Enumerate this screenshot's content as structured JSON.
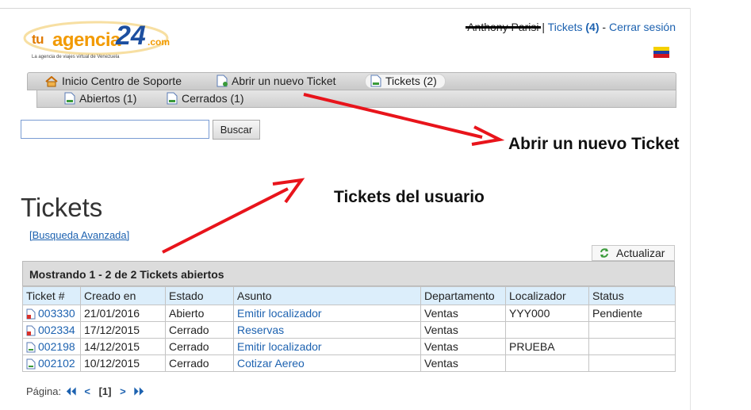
{
  "brand": {
    "tu": "tu",
    "agencia": "agencia",
    "num": "24",
    "dotcom": ".com",
    "tagline": "La agencia de viajes virtual de Venezuela"
  },
  "userbar": {
    "user_name": "Anthony Parisi",
    "separator": "|",
    "tickets_label": "Tickets",
    "tickets_count": "(4)",
    "dash": "-",
    "logout": "Cerrar sesión"
  },
  "nav": {
    "home": "Inicio Centro de Soporte",
    "new_ticket": "Abrir un nuevo Ticket",
    "tickets": "Tickets (2)",
    "open": "Abiertos (1)",
    "closed": "Cerrados (1)"
  },
  "search": {
    "value": "",
    "button": "Buscar"
  },
  "page_title": "Tickets",
  "advanced_search": "[Busqueda Avanzada]",
  "refresh_label": "Actualizar",
  "table": {
    "caption": "Mostrando  1 - 2 de 2 Tickets abiertos",
    "headers": [
      "Ticket #",
      "Creado en",
      "Estado",
      "Asunto",
      "Departamento",
      "Localizador",
      "Status"
    ],
    "rows": [
      {
        "ticket": "003330",
        "created": "21/01/2016",
        "state": "Abierto",
        "subject": "Emitir localizador",
        "department": "Ventas",
        "locator": "YYY000",
        "status": "Pendiente",
        "icon": "doc-red-icon"
      },
      {
        "ticket": "002334",
        "created": "17/12/2015",
        "state": "Cerrado",
        "subject": "Reservas",
        "department": "Ventas",
        "locator": "",
        "status": "",
        "icon": "doc-red-icon"
      },
      {
        "ticket": "002198",
        "created": "14/12/2015",
        "state": "Cerrado",
        "subject": "Emitir localizador",
        "department": "Ventas",
        "locator": "PRUEBA",
        "status": "",
        "icon": "doc-icon"
      },
      {
        "ticket": "002102",
        "created": "10/12/2015",
        "state": "Cerrado",
        "subject": "Cotizar Aereo",
        "department": "Ventas",
        "locator": "",
        "status": "",
        "icon": "doc-icon"
      }
    ]
  },
  "pager": {
    "label": "Página:",
    "first": "⏴⏴",
    "prev": "<",
    "current": "[1]",
    "next": ">",
    "last": "⏵⏵"
  },
  "annotations": {
    "new_ticket": "Abrir un nuevo Ticket",
    "user_tickets": "Tickets del usuario"
  },
  "colors": {
    "link": "#1d62b0",
    "arrow": "#e8141b",
    "header_bg": "#dceefb"
  }
}
